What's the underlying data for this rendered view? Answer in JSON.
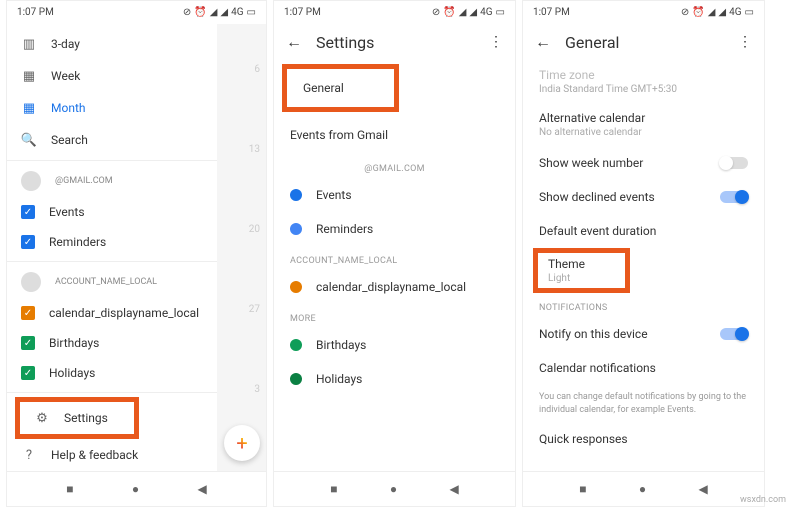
{
  "status": {
    "time": "1:07 PM",
    "network": "4G"
  },
  "screen1": {
    "views": {
      "three_day": "3-day",
      "week": "Week",
      "month": "Month",
      "search": "Search"
    },
    "account1": "@GMAIL.COM",
    "events": "Events",
    "reminders": "Reminders",
    "account2": "ACCOUNT_NAME_LOCAL",
    "cal_local": "calendar_displayname_local",
    "birthdays": "Birthdays",
    "holidays": "Holidays",
    "settings": "Settings",
    "help": "Help & feedback",
    "bg_days": [
      "6",
      "13",
      "20",
      "27",
      "3"
    ]
  },
  "screen2": {
    "title": "Settings",
    "general": "General",
    "events_gmail": "Events from Gmail",
    "section_account": "@GMAIL.COM",
    "events": "Events",
    "reminders": "Reminders",
    "section_local": "ACCOUNT_NAME_LOCAL",
    "cal_local": "calendar_displayname_local",
    "section_more": "MORE",
    "birthdays": "Birthdays",
    "holidays": "Holidays"
  },
  "screen3": {
    "title": "General",
    "timezone_label": "Time zone",
    "timezone_value": "India Standard Time  GMT+5:30",
    "alt_cal": "Alternative calendar",
    "alt_cal_sub": "No alternative calendar",
    "show_week": "Show week number",
    "show_declined": "Show declined events",
    "default_duration": "Default event duration",
    "theme": "Theme",
    "theme_value": "Light",
    "notifications": "NOTIFICATIONS",
    "notify_device": "Notify on this device",
    "cal_notifications": "Calendar notifications",
    "hint": "You can change default notifications by going to the individual calendar, for example Events.",
    "quick": "Quick responses"
  },
  "watermark": "wsxdn.com"
}
